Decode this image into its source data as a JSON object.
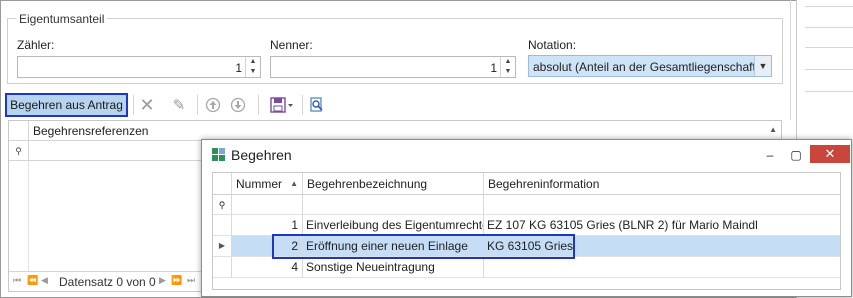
{
  "group": {
    "title": "Eigentumsanteil"
  },
  "fields": {
    "zaehler_label": "Zähler:",
    "zaehler_value": "1",
    "nenner_label": "Nenner:",
    "nenner_value": "1",
    "notation_label": "Notation:",
    "notation_value": "absolut (Anteil an der Gesamtliegenschaft)"
  },
  "toolbar": {
    "begehren_button": "Begehren aus Antrag",
    "icons": [
      "delete-icon",
      "edit-icon",
      "move-up-icon",
      "move-down-icon",
      "save-icon",
      "search-icon"
    ]
  },
  "bggrid": {
    "column": "Begehrensreferenzen",
    "nav_record": "Datensatz 0 von 0"
  },
  "dialog": {
    "title": "Begehren",
    "close_glyph": "✕",
    "minimize_glyph": "–",
    "maximize_glyph": "▢",
    "columns": [
      "Nummer",
      "Begehrenbezeichnung",
      "Begehreninformation"
    ],
    "rows": [
      {
        "nummer": "1",
        "bezeichnung": "Einverleibung des Eigentumrechtes",
        "information": "EZ 107 KG 63105 Gries (BLNR 2) für Mario Maindl"
      },
      {
        "nummer": "2",
        "bezeichnung": "Eröffnung einer neuen Einlage",
        "information": "KG 63105 Gries"
      },
      {
        "nummer": "4",
        "bezeichnung": "Sonstige Neueintragung",
        "information": ""
      }
    ],
    "selected_row": 1
  },
  "colors": {
    "highlight_border": "#1f35c8",
    "selection": "#c5ddf5",
    "close_red": "#c9463d"
  }
}
